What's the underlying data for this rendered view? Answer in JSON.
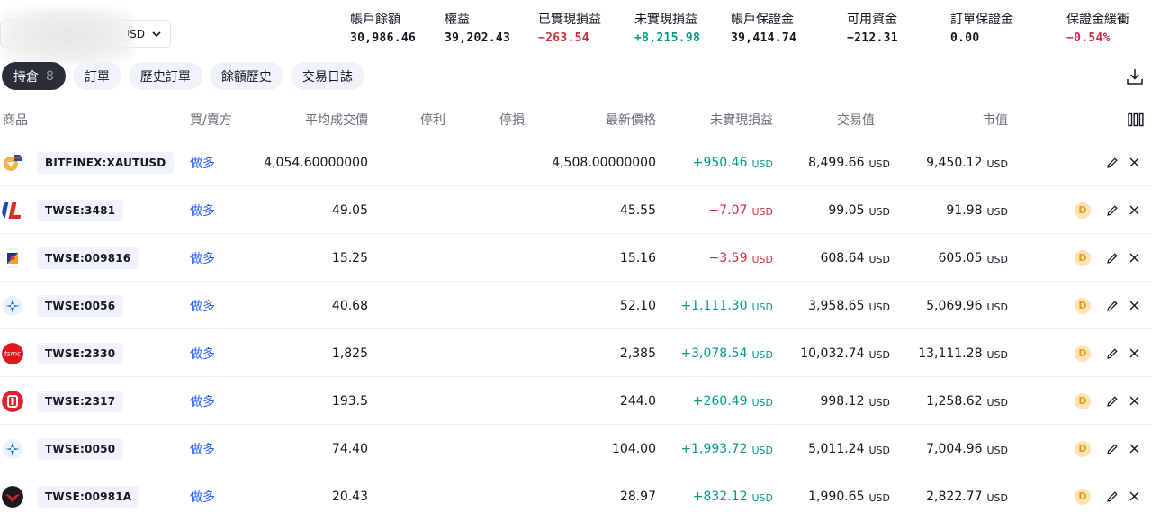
{
  "account": {
    "currency": "USD"
  },
  "summary": [
    {
      "label": "帳戶餘額",
      "value": "30,986.46",
      "tone": ""
    },
    {
      "label": "權益",
      "value": "39,202.43",
      "tone": ""
    },
    {
      "label": "已實現損益",
      "value": "−263.54",
      "tone": "neg"
    },
    {
      "label": "未實現損益",
      "value": "+8,215.98",
      "tone": "pos"
    },
    {
      "label": "帳戶保證金",
      "value": "39,414.74",
      "tone": ""
    },
    {
      "label": "可用資金",
      "value": "−212.31",
      "tone": ""
    },
    {
      "label": "訂單保證金",
      "value": "0.00",
      "tone": ""
    },
    {
      "label": "保證金緩衝",
      "value": "−0.54%",
      "tone": "neg"
    }
  ],
  "tabs": [
    {
      "label": "持倉",
      "count": "8",
      "active": true
    },
    {
      "label": "訂單",
      "active": false
    },
    {
      "label": "歷史訂單",
      "active": false
    },
    {
      "label": "餘額歷史",
      "active": false
    },
    {
      "label": "交易日誌",
      "active": false
    }
  ],
  "columns": {
    "product": "商品",
    "side": "買/賣方",
    "avg": "平均成交價",
    "tp": "停利",
    "sl": "停損",
    "last": "最新價格",
    "pnl": "未實現損益",
    "trade_value": "交易值",
    "market_value": "市值"
  },
  "icons": {
    "download": "download-icon",
    "columns": "columns-icon",
    "chevron": "chevron-down-icon",
    "edit": "pencil-icon",
    "close": "close-icon",
    "dividend": "dividend-badge-icon"
  },
  "unit": "USD",
  "rows": [
    {
      "ticker": "BITFINEX:XAUTUSD",
      "side": "做多",
      "avg": "4,054.60000000",
      "last": "4,508.00000000",
      "pnl": "+950.46",
      "pnl_tone": "pos",
      "trade_value": "8,499.66",
      "market_value": "9,450.12",
      "dividend": "",
      "logo": "xaut"
    },
    {
      "ticker": "TWSE:3481",
      "side": "做多",
      "avg": "49.05",
      "last": "45.55",
      "pnl": "−7.07",
      "pnl_tone": "neg",
      "trade_value": "99.05",
      "market_value": "91.98",
      "dividend": "D",
      "logo": "innolux"
    },
    {
      "ticker": "TWSE:009816",
      "side": "做多",
      "avg": "15.25",
      "last": "15.16",
      "pnl": "−3.59",
      "pnl_tone": "neg",
      "trade_value": "608.64",
      "market_value": "605.05",
      "dividend": "D",
      "logo": "etf"
    },
    {
      "ticker": "TWSE:0056",
      "side": "做多",
      "avg": "40.68",
      "last": "52.10",
      "pnl": "+1,111.30",
      "pnl_tone": "pos",
      "trade_value": "3,958.65",
      "market_value": "5,069.96",
      "dividend": "D",
      "logo": "yuanta"
    },
    {
      "ticker": "TWSE:2330",
      "side": "做多",
      "avg": "1,825",
      "last": "2,385",
      "pnl": "+3,078.54",
      "pnl_tone": "pos",
      "trade_value": "10,032.74",
      "market_value": "13,111.28",
      "dividend": "D",
      "logo": "tsmc"
    },
    {
      "ticker": "TWSE:2317",
      "side": "做多",
      "avg": "193.5",
      "last": "244.0",
      "pnl": "+260.49",
      "pnl_tone": "pos",
      "trade_value": "998.12",
      "market_value": "1,258.62",
      "dividend": "D",
      "logo": "hon"
    },
    {
      "ticker": "TWSE:0050",
      "side": "做多",
      "avg": "74.40",
      "last": "104.00",
      "pnl": "+1,993.72",
      "pnl_tone": "pos",
      "trade_value": "5,011.24",
      "market_value": "7,004.96",
      "dividend": "D",
      "logo": "yuanta"
    },
    {
      "ticker": "TWSE:00981A",
      "side": "做多",
      "avg": "20.43",
      "last": "28.97",
      "pnl": "+832.12",
      "pnl_tone": "pos",
      "trade_value": "1,990.65",
      "market_value": "2,822.77",
      "dividend": "D",
      "logo": "unified"
    }
  ],
  "logo_text": {
    "tsmc": "tsmc"
  }
}
